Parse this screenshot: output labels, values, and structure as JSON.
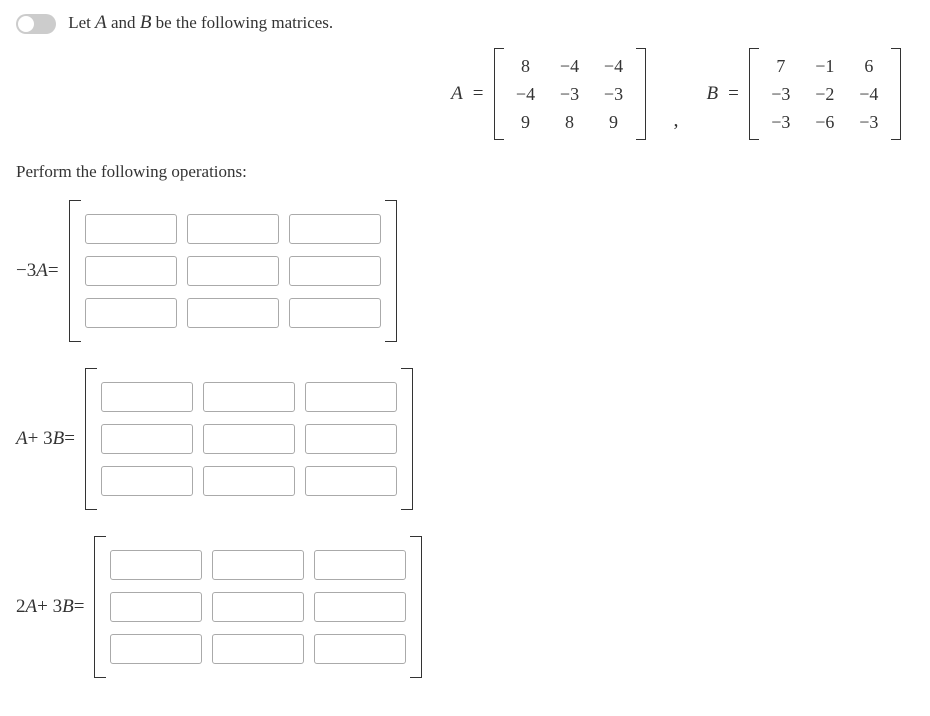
{
  "intro": {
    "prefix": "Let ",
    "var1": "A",
    "mid": " and ",
    "var2": "B",
    "suffix": " be the following matrices."
  },
  "matrixA": {
    "label": "A",
    "rows": [
      [
        "8",
        "−4",
        "−4"
      ],
      [
        "−4",
        "−3",
        "−3"
      ],
      [
        "9",
        "8",
        "9"
      ]
    ]
  },
  "matrixB": {
    "label": "B",
    "rows": [
      [
        "7",
        "−1",
        "6"
      ],
      [
        "−3",
        "−2",
        "−4"
      ],
      [
        "−3",
        "−6",
        "−3"
      ]
    ]
  },
  "perform_text": "Perform the following operations:",
  "operations": [
    {
      "label_html": "−3<span class='mathvar'>A</span> ="
    },
    {
      "label_html": "<span class='mathvar'>A</span> + 3<span class='mathvar'>B</span> ="
    },
    {
      "label_html": "2<span class='mathvar'>A</span> + 3<span class='mathvar'>B</span> ="
    }
  ],
  "comma": ","
}
